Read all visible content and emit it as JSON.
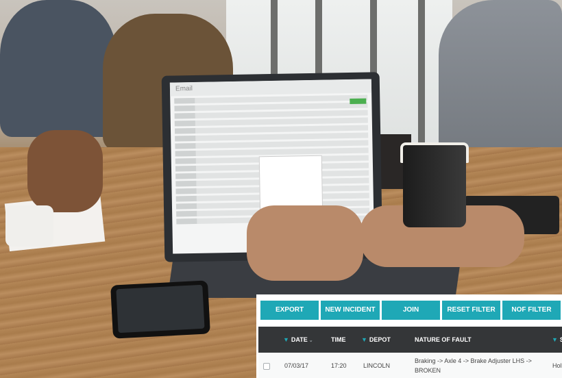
{
  "colors": {
    "accent": "#1fa8b6",
    "table_header_bg": "#343638",
    "button_text": "#ffffff"
  },
  "photo": {
    "screen_app_title": "Email"
  },
  "toolbar": {
    "buttons": [
      "EXPORT",
      "NEW INCIDENT",
      "JOIN",
      "RESET FILTER",
      "NOF FILTER"
    ]
  },
  "table": {
    "columns": [
      {
        "label": "DATE",
        "filter_icon": "filter-icon",
        "sort_icon": "sort-icon"
      },
      {
        "label": "TIME"
      },
      {
        "label": "DEPOT",
        "filter_icon": "filter-icon"
      },
      {
        "label": "NATURE OF FAULT"
      },
      {
        "label": "S",
        "filter_icon": "filter-icon"
      }
    ],
    "rows": [
      {
        "date": "07/03/17",
        "time": "17:20",
        "depot": "LINCOLN",
        "fault_line1": "Braking -> Axle 4 -> Brake Adjuster LHS ->",
        "fault_line2": "BROKEN",
        "status": "Hol"
      }
    ]
  }
}
